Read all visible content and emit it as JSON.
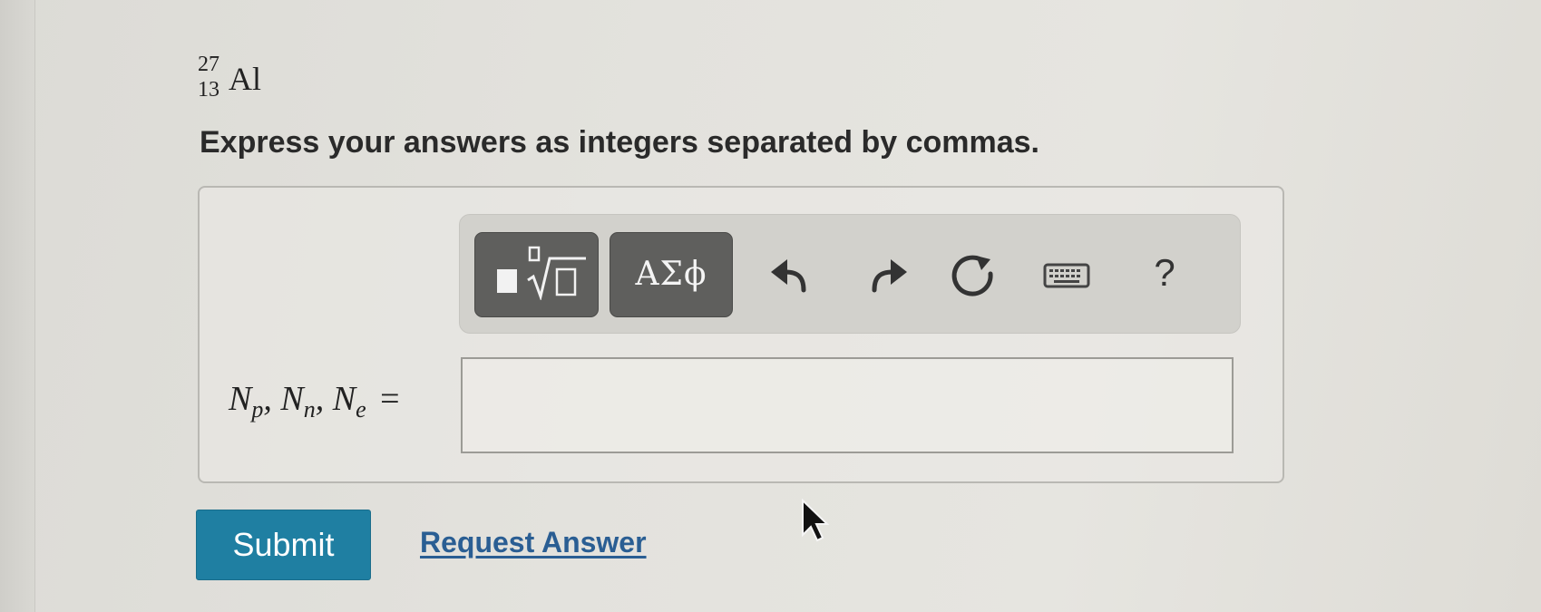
{
  "question": {
    "isotope": {
      "mass_number": "27",
      "atomic_number": "13",
      "symbol": "Al"
    },
    "instruction": "Express your answers as integers separated by commas."
  },
  "toolbar": {
    "templates_icon": "templates-radical-icon",
    "greek_label": "ΑΣϕ",
    "undo_icon": "undo-icon",
    "redo_icon": "redo-icon",
    "reset_icon": "reset-icon",
    "keyboard_icon": "keyboard-icon",
    "help_label": "?"
  },
  "answer": {
    "label_parts": {
      "n1": "N",
      "s1": "p",
      "sep1": ", ",
      "n2": "N",
      "s2": "n",
      "sep2": ", ",
      "n3": "N",
      "s3": "e",
      "equals": "="
    },
    "value": ""
  },
  "actions": {
    "submit_label": "Submit",
    "request_label": "Request Answer"
  },
  "colors": {
    "submit_bg": "#1f7fa2",
    "link": "#2a5e93",
    "toolbar_button": "#5f5f5d"
  }
}
